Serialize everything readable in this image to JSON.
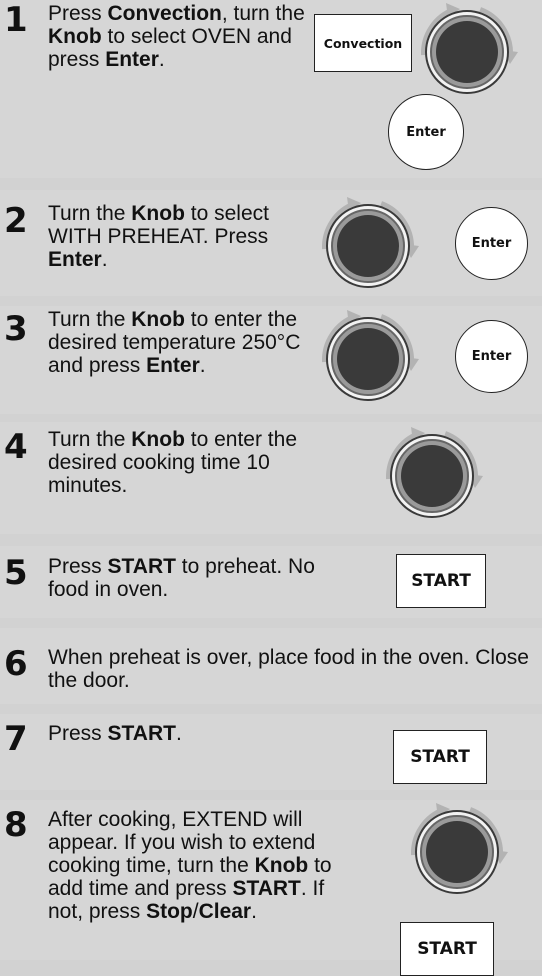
{
  "steps": [
    {
      "number": "1",
      "parts": [
        {
          "t": "Press ",
          "b": false
        },
        {
          "t": "Convection",
          "b": true
        },
        {
          "t": ", turn the ",
          "b": false
        },
        {
          "t": "Knob",
          "b": true
        },
        {
          "t": " to select OVEN and press ",
          "b": false
        },
        {
          "t": "Enter",
          "b": true
        },
        {
          "t": ".",
          "b": false
        }
      ],
      "convection_label": "Convection",
      "enter_label": "Enter"
    },
    {
      "number": "2",
      "parts": [
        {
          "t": "Turn the ",
          "b": false
        },
        {
          "t": "Knob",
          "b": true
        },
        {
          "t": " to select WITH PREHEAT. Press ",
          "b": false
        },
        {
          "t": "Enter",
          "b": true
        },
        {
          "t": ".",
          "b": false
        }
      ],
      "enter_label": "Enter"
    },
    {
      "number": "3",
      "parts": [
        {
          "t": "Turn the ",
          "b": false
        },
        {
          "t": "Knob",
          "b": true
        },
        {
          "t": " to enter the desired temperature 250°C and press ",
          "b": false
        },
        {
          "t": "Enter",
          "b": true
        },
        {
          "t": ".",
          "b": false
        }
      ],
      "enter_label": "Enter"
    },
    {
      "number": "4",
      "parts": [
        {
          "t": "Turn the ",
          "b": false
        },
        {
          "t": "Knob",
          "b": true
        },
        {
          "t": " to enter the desired cooking time 10 minutes.",
          "b": false
        }
      ]
    },
    {
      "number": "5",
      "parts": [
        {
          "t": "Press ",
          "b": false
        },
        {
          "t": "START",
          "b": true
        },
        {
          "t": " to preheat. No food in oven.",
          "b": false
        }
      ],
      "start_label": "START"
    },
    {
      "number": "6",
      "parts": [
        {
          "t": "When preheat is over, place food in the oven. Close the door.",
          "b": false
        }
      ]
    },
    {
      "number": "7",
      "parts": [
        {
          "t": "Press ",
          "b": false
        },
        {
          "t": "START",
          "b": true
        },
        {
          "t": ".",
          "b": false
        }
      ],
      "start_label": "START"
    },
    {
      "number": "8",
      "parts": [
        {
          "t": "After cooking, EXTEND will appear. If you wish to extend cooking time, turn the ",
          "b": false
        },
        {
          "t": "Knob",
          "b": true
        },
        {
          "t": " to add time and press ",
          "b": false
        },
        {
          "t": "START",
          "b": true
        },
        {
          "t": ". If not, press ",
          "b": false
        },
        {
          "t": "Stop",
          "b": true
        },
        {
          "t": "/",
          "b": false
        },
        {
          "t": "Clear",
          "b": true
        },
        {
          "t": ".",
          "b": false
        }
      ],
      "start_label": "START"
    }
  ]
}
